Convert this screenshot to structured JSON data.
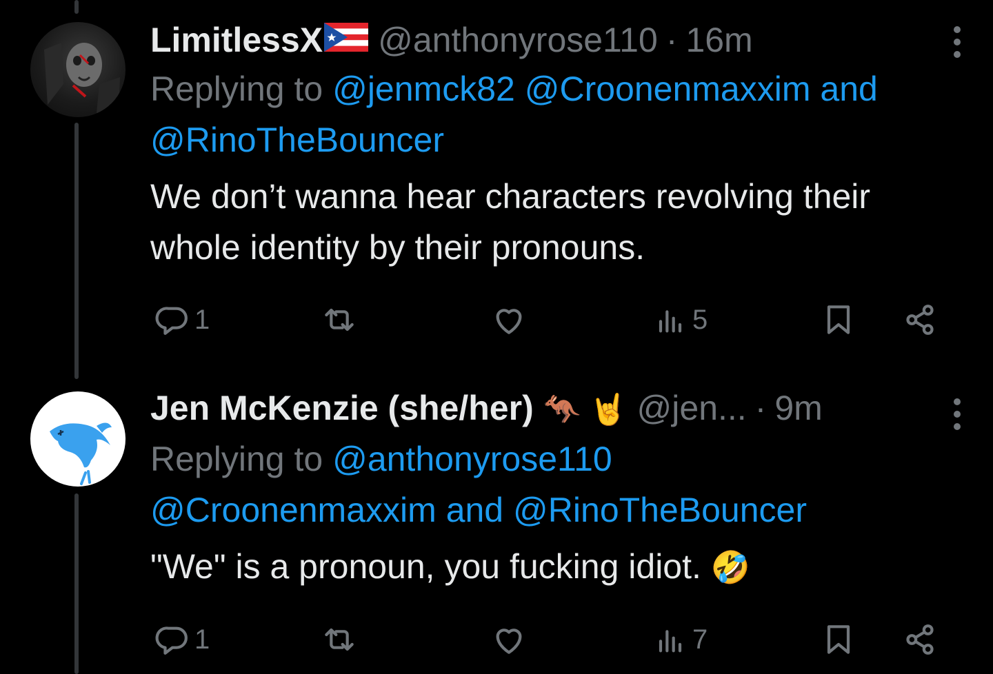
{
  "tweets": [
    {
      "display_name": "LimitlessX",
      "flag_icon": "puerto-rico-flag-icon",
      "handle": "@anthonyrose110",
      "separator": "·",
      "time": "16m",
      "replying_prefix": "Replying to",
      "mention_1": "@jenmck82",
      "mention_2": "@Croonenmaxxim",
      "mention_and": "and",
      "mention_3": "@RinoTheBouncer",
      "text": "We don’t wanna hear characters revolving their whole identity by their pronouns.",
      "stats": {
        "replies": "1",
        "reposts": "",
        "likes": "",
        "views": "5"
      }
    },
    {
      "display_name": "Jen McKenzie (she/her)",
      "name_emoji": "🦘 🤘",
      "handle": "@jen...",
      "separator": "·",
      "time": "9m",
      "replying_prefix": "Replying to",
      "mention_1": "@anthonyrose110",
      "mention_2": "@Croonenmaxxim",
      "mention_and": "and",
      "mention_3": "@RinoTheBouncer",
      "text": "\"We\" is a pronoun, you fucking idiot.",
      "text_emoji": "🤣",
      "stats": {
        "replies": "1",
        "reposts": "",
        "likes": "",
        "views": "7"
      }
    }
  ],
  "colors": {
    "background": "#000000",
    "primary_text": "#e7e9ea",
    "secondary_text": "#71767b",
    "link": "#1d9bf0",
    "thread_line": "#333639"
  }
}
